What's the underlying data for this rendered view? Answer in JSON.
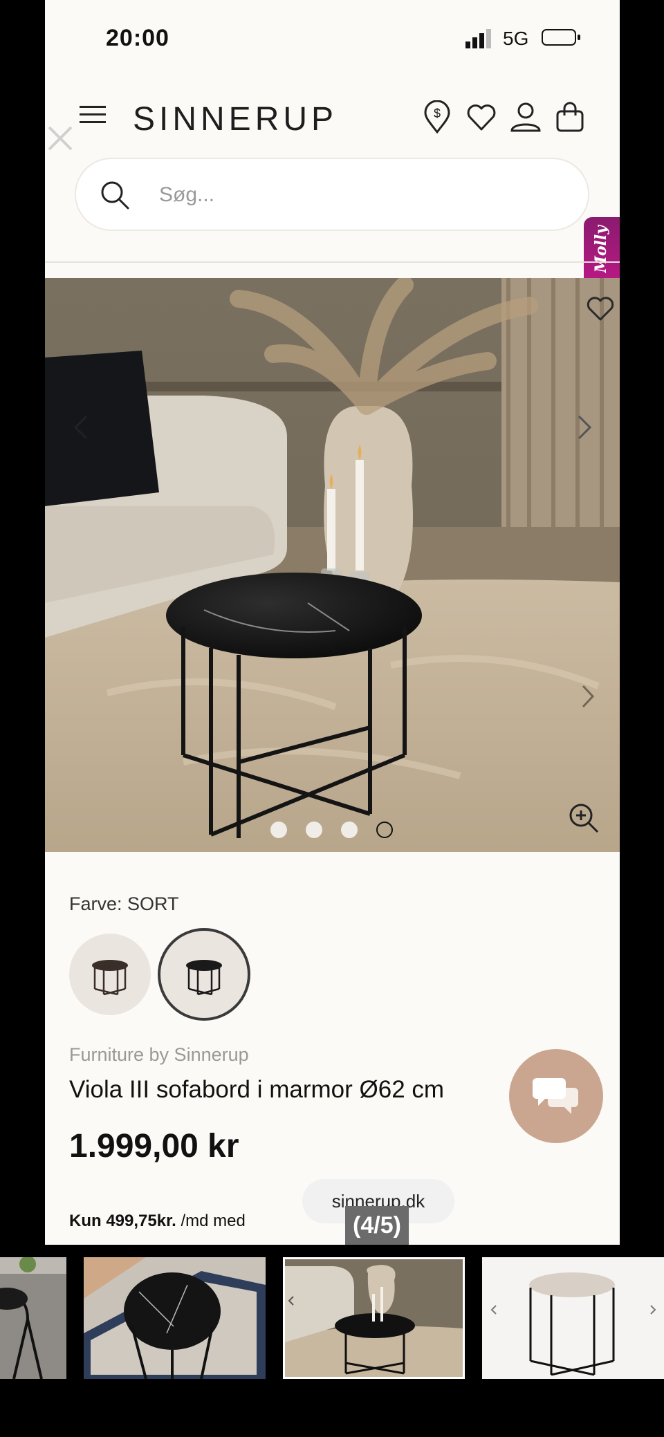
{
  "status_bar": {
    "time": "20:00",
    "network": "5G"
  },
  "header": {
    "logo": "SINNERUP"
  },
  "search": {
    "placeholder": "Søg..."
  },
  "assistant": {
    "label": "Molly"
  },
  "gallery": {
    "current_slide": 4,
    "total_dots": 4,
    "active_dot": 4
  },
  "product": {
    "color_label": "Farve: SORT",
    "brand": "Furniture by Sinnerup",
    "name": "Viola III sofabord i marmor Ø62 cm",
    "price": "1.999,00 kr",
    "installment_amount": "Kun 499,75kr.",
    "installment_text": "/md med"
  },
  "overlay": {
    "url": "sinnerup.dk",
    "counter": "(4/5)"
  },
  "colors": {
    "background": "#fcfaf6",
    "chat_button": "#caa690",
    "molly": "#b0187f"
  }
}
